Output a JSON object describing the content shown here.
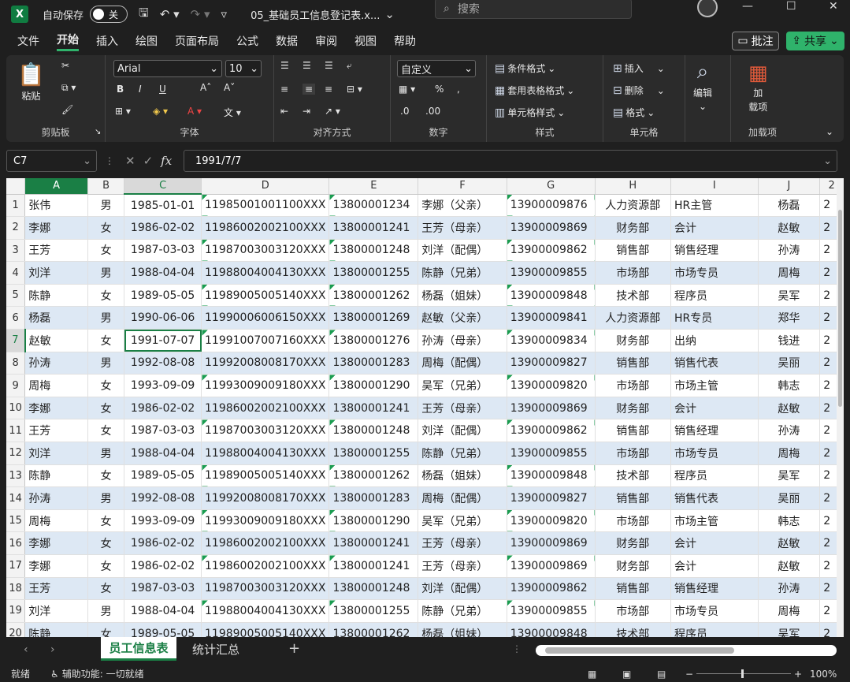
{
  "titlebar": {
    "logo": "X",
    "autosave_label": "自动保存",
    "autosave_state": "关",
    "doc_title": "05_基础员工信息登记表.x...",
    "search_placeholder": "搜索"
  },
  "menu": {
    "items": [
      "文件",
      "开始",
      "插入",
      "绘图",
      "页面布局",
      "公式",
      "数据",
      "审阅",
      "视图",
      "帮助"
    ],
    "active": "开始",
    "comment_label": "批注",
    "share_label": "共享"
  },
  "ribbon": {
    "clipboard": {
      "paste_label": "粘贴",
      "group_label": "剪贴板"
    },
    "font": {
      "font_name": "Arial",
      "font_size": "10",
      "group_label": "字体",
      "bold": "B",
      "italic": "I",
      "underline": "U"
    },
    "alignment": {
      "group_label": "对齐方式"
    },
    "number": {
      "format": "自定义",
      "group_label": "数字"
    },
    "styles": {
      "conditional_label": "条件格式",
      "table_label": "套用表格格式",
      "cell_style_label": "单元格样式",
      "group_label": "样式"
    },
    "cells": {
      "insert_label": "插入",
      "delete_label": "删除",
      "format_label": "格式",
      "group_label": "单元格"
    },
    "editing": {
      "label": "编辑"
    },
    "addins": {
      "button_line1": "加",
      "button_line2": "载项",
      "group_label": "加载项"
    }
  },
  "formula_bar": {
    "name_box": "C7",
    "formula": "1991/7/7"
  },
  "columns": [
    "A",
    "B",
    "C",
    "D",
    "E",
    "F",
    "G",
    "H",
    "I",
    "J",
    "2"
  ],
  "rows": [
    [
      "1",
      "张伟",
      "男",
      "1985-01-01",
      "11985001001100XXX",
      "13800001234",
      "李娜（父亲）",
      "13900009876",
      "人力资源部",
      "HR主管",
      "杨磊",
      "2"
    ],
    [
      "2",
      "李娜",
      "女",
      "1986-02-02",
      "11986002002100XXX",
      "13800001241",
      "王芳（母亲）",
      "13900009869",
      "财务部",
      "会计",
      "赵敏",
      "2"
    ],
    [
      "3",
      "王芳",
      "女",
      "1987-03-03",
      "11987003003120XXX",
      "13800001248",
      "刘洋（配偶）",
      "13900009862",
      "销售部",
      "销售经理",
      "孙涛",
      "2"
    ],
    [
      "4",
      "刘洋",
      "男",
      "1988-04-04",
      "11988004004130XXX",
      "13800001255",
      "陈静（兄弟）",
      "13900009855",
      "市场部",
      "市场专员",
      "周梅",
      "2"
    ],
    [
      "5",
      "陈静",
      "女",
      "1989-05-05",
      "11989005005140XXX",
      "13800001262",
      "杨磊（姐妹）",
      "13900009848",
      "技术部",
      "程序员",
      "吴军",
      "2"
    ],
    [
      "6",
      "杨磊",
      "男",
      "1990-06-06",
      "11990006006150XXX",
      "13800001269",
      "赵敏（父亲）",
      "13900009841",
      "人力资源部",
      "HR专员",
      "郑华",
      "2"
    ],
    [
      "7",
      "赵敏",
      "女",
      "1991-07-07",
      "11991007007160XXX",
      "13800001276",
      "孙涛（母亲）",
      "13900009834",
      "财务部",
      "出纳",
      "钱进",
      "2"
    ],
    [
      "8",
      "孙涛",
      "男",
      "1992-08-08",
      "11992008008170XXX",
      "13800001283",
      "周梅（配偶）",
      "13900009827",
      "销售部",
      "销售代表",
      "吴丽",
      "2"
    ],
    [
      "9",
      "周梅",
      "女",
      "1993-09-09",
      "11993009009180XXX",
      "13800001290",
      "吴军（兄弟）",
      "13900009820",
      "市场部",
      "市场主管",
      "韩志",
      "2"
    ],
    [
      "10",
      "李娜",
      "女",
      "1986-02-02",
      "11986002002100XXX",
      "13800001241",
      "王芳（母亲）",
      "13900009869",
      "财务部",
      "会计",
      "赵敏",
      "2"
    ],
    [
      "11",
      "王芳",
      "女",
      "1987-03-03",
      "11987003003120XXX",
      "13800001248",
      "刘洋（配偶）",
      "13900009862",
      "销售部",
      "销售经理",
      "孙涛",
      "2"
    ],
    [
      "12",
      "刘洋",
      "男",
      "1988-04-04",
      "11988004004130XXX",
      "13800001255",
      "陈静（兄弟）",
      "13900009855",
      "市场部",
      "市场专员",
      "周梅",
      "2"
    ],
    [
      "13",
      "陈静",
      "女",
      "1989-05-05",
      "11989005005140XXX",
      "13800001262",
      "杨磊（姐妹）",
      "13900009848",
      "技术部",
      "程序员",
      "吴军",
      "2"
    ],
    [
      "14",
      "孙涛",
      "男",
      "1992-08-08",
      "11992008008170XXX",
      "13800001283",
      "周梅（配偶）",
      "13900009827",
      "销售部",
      "销售代表",
      "吴丽",
      "2"
    ],
    [
      "15",
      "周梅",
      "女",
      "1993-09-09",
      "11993009009180XXX",
      "13800001290",
      "吴军（兄弟）",
      "13900009820",
      "市场部",
      "市场主管",
      "韩志",
      "2"
    ],
    [
      "16",
      "李娜",
      "女",
      "1986-02-02",
      "11986002002100XXX",
      "13800001241",
      "王芳（母亲）",
      "13900009869",
      "财务部",
      "会计",
      "赵敏",
      "2"
    ],
    [
      "17",
      "李娜",
      "女",
      "1986-02-02",
      "11986002002100XXX",
      "13800001241",
      "王芳（母亲）",
      "13900009869",
      "财务部",
      "会计",
      "赵敏",
      "2"
    ],
    [
      "18",
      "王芳",
      "女",
      "1987-03-03",
      "11987003003120XXX",
      "13800001248",
      "刘洋（配偶）",
      "13900009862",
      "销售部",
      "销售经理",
      "孙涛",
      "2"
    ],
    [
      "19",
      "刘洋",
      "男",
      "1988-04-04",
      "11988004004130XXX",
      "13800001255",
      "陈静（兄弟）",
      "13900009855",
      "市场部",
      "市场专员",
      "周梅",
      "2"
    ],
    [
      "20",
      "陈静",
      "女",
      "1989-05-05",
      "11989005005140XXX",
      "13800001262",
      "杨磊（姐妹）",
      "13900009848",
      "技术部",
      "程序员",
      "吴军",
      "2"
    ]
  ],
  "sheets": {
    "tabs": [
      "员工信息表",
      "统计汇总"
    ],
    "active": "员工信息表",
    "add_label": "+"
  },
  "status": {
    "ready": "就绪",
    "accessibility": "辅助功能: 一切就绪",
    "zoom": "100%"
  },
  "colors": {
    "accent": "#1a7f45",
    "share": "#2fb36b",
    "row_band": "#dde8f4"
  }
}
